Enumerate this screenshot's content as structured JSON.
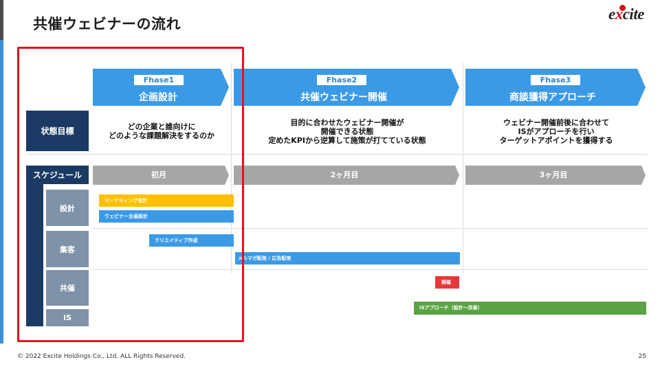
{
  "title": "共催ウェビナーの流れ",
  "logo": {
    "pre": "e",
    "mid": "x",
    "post": "cite"
  },
  "phases": [
    {
      "badge": "Fhase1",
      "name": "企画設計"
    },
    {
      "badge": "Fhase2",
      "name": "共催ウェビナー開催"
    },
    {
      "badge": "Fhase3",
      "name": "商談獲得アプローチ"
    }
  ],
  "row_labels": {
    "goal": "状態目標",
    "schedule": "スケジュール"
  },
  "goals": [
    [
      "どの企業と誰向けに",
      "どのような課題解決をするのか"
    ],
    [
      "目的に合わせたウェビナー開催が",
      "開催できる状態",
      "定めたKPIから逆算して施策が打てている状態"
    ],
    [
      "ウェビナー開催前後に合わせて",
      "ISがアプローチを行い",
      "ターゲットアポイントを獲得する"
    ]
  ],
  "months": [
    "初月",
    "2ヶ月目",
    "3ヶ月目"
  ],
  "categories": [
    "設計",
    "集客",
    "共催",
    "IS"
  ],
  "tasks": {
    "marketing": "マーケティング設計",
    "webinar_plan": "ウェビナー企画設計",
    "creative": "クリエイティブ作成",
    "mailmag": "メルマガ配信 / 広告配信",
    "event": "開催",
    "is_approach": "ISアプローチ（設計～改善）"
  },
  "colors": {
    "phase": "#3b9ae6",
    "navy": "#1b3a63",
    "category": "#7f93a8",
    "month": "#a6a6a6",
    "marketing": "#ffc000",
    "blue_task": "#3b9ae6",
    "event": "#e8363b",
    "is": "#5aa345",
    "frame": "#e3131b"
  },
  "footer": "© 2022 Excite Holdings Co., Ltd. ALL Rights Reserved.",
  "page_number": "25"
}
